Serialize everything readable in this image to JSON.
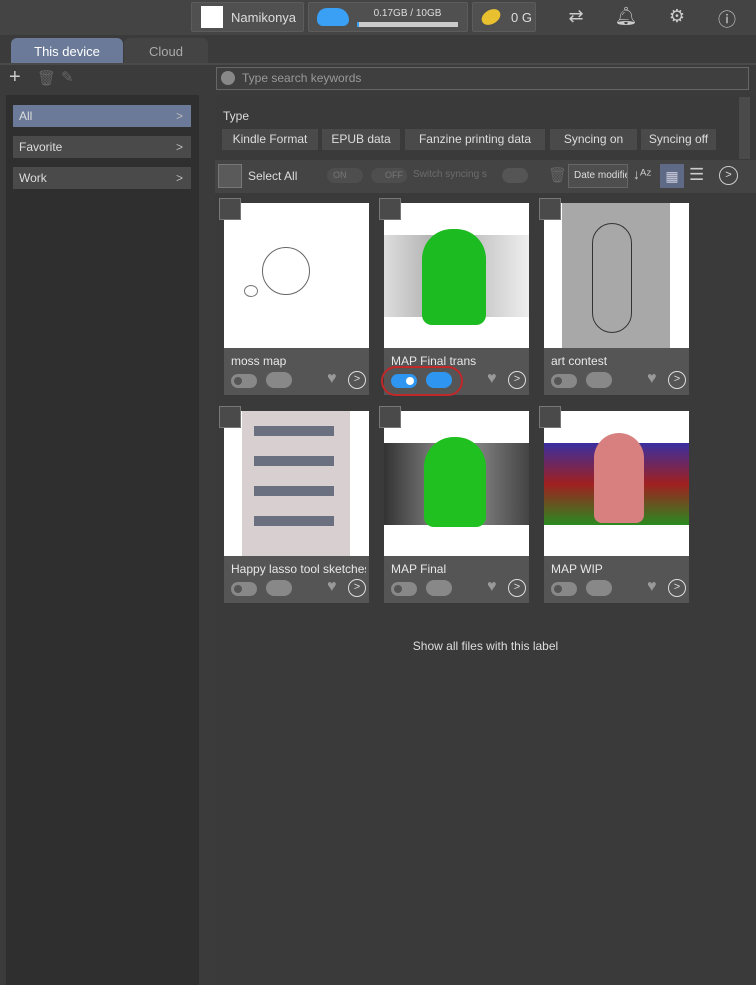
{
  "topbar": {
    "username": "Namikonya",
    "storage": "0.17GB / 10GB",
    "storage_fraction": 0.017,
    "coins": "0 G"
  },
  "tabs": [
    "This device",
    "Cloud"
  ],
  "search": {
    "placeholder": "Type search keywords"
  },
  "sidebar": {
    "items": [
      {
        "label": "All"
      },
      {
        "label": "Favorite"
      },
      {
        "label": "Work"
      }
    ]
  },
  "type_label": "Type",
  "chips": [
    "Kindle Format",
    "EPUB data",
    "Fanzine printing data",
    "Syncing on",
    "Syncing off"
  ],
  "toolbar": {
    "select_all": "Select All",
    "on": "ON",
    "off": "OFF",
    "switch_sync": "Switch syncing st",
    "sort": "Date modifie"
  },
  "cards": [
    {
      "name": "moss map",
      "sync": false,
      "img": "sketch"
    },
    {
      "name": "MAP Final trans",
      "sync": true,
      "img": "green"
    },
    {
      "name": "art contest",
      "sync": false,
      "img": "gray"
    },
    {
      "name": "Happy lasso tool sketches and do",
      "sync": false,
      "img": "figures"
    },
    {
      "name": "MAP Final",
      "sync": false,
      "img": "greendark"
    },
    {
      "name": "MAP WIP",
      "sync": false,
      "img": "color"
    }
  ],
  "show_all": "Show all files with this label"
}
